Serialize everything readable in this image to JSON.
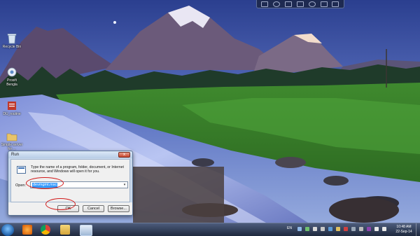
{
  "desktop": {
    "icons": [
      {
        "label": "Recycle Bin"
      },
      {
        "label": "Proxifi\nBengla"
      },
      {
        "label": "DU_routine"
      },
      {
        "label": "Simple server\nfor ..."
      }
    ]
  },
  "run_dialog": {
    "title": "Run",
    "close_label": "x",
    "description": "Type the name of a program, folder, document, or Internet resource, and Windows will open it for you.",
    "open_label": "Open:",
    "open_value": "devmgmt.msc",
    "dropdown_glyph": "▾",
    "ok_label": "OK",
    "cancel_label": "Cancel",
    "browse_label": "Browse..."
  },
  "taskbar": {
    "language": "EN",
    "clock_time": "10:48 AM",
    "clock_date": "22-Sep-14"
  },
  "colors": {
    "highlight_mark": "#d11a1a",
    "selection": "#3399ff"
  }
}
